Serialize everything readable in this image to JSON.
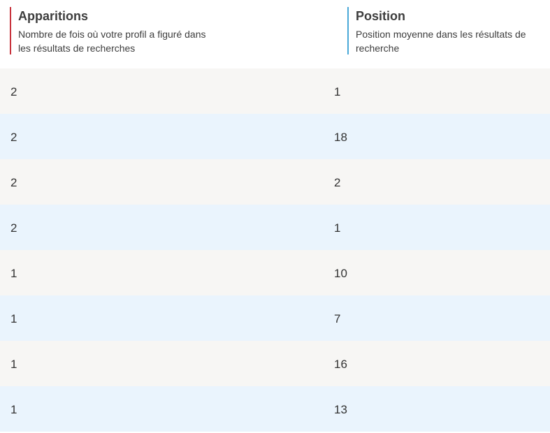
{
  "header": {
    "appearances": {
      "title": "Apparitions",
      "description": "Nombre de fois où votre profil a figuré dans les résultats de recherches"
    },
    "position": {
      "title": "Position",
      "description": "Position moyenne dans les résultats de recherche"
    }
  },
  "colors": {
    "appearances_accent": "#c8323c",
    "position_accent": "#4aa8d8",
    "row_odd": "#f7f6f4",
    "row_even": "#eaf4fd"
  },
  "rows": [
    {
      "appearances": "2",
      "position": "1"
    },
    {
      "appearances": "2",
      "position": "18"
    },
    {
      "appearances": "2",
      "position": "2"
    },
    {
      "appearances": "2",
      "position": "1"
    },
    {
      "appearances": "1",
      "position": "10"
    },
    {
      "appearances": "1",
      "position": "7"
    },
    {
      "appearances": "1",
      "position": "16"
    },
    {
      "appearances": "1",
      "position": "13"
    }
  ]
}
